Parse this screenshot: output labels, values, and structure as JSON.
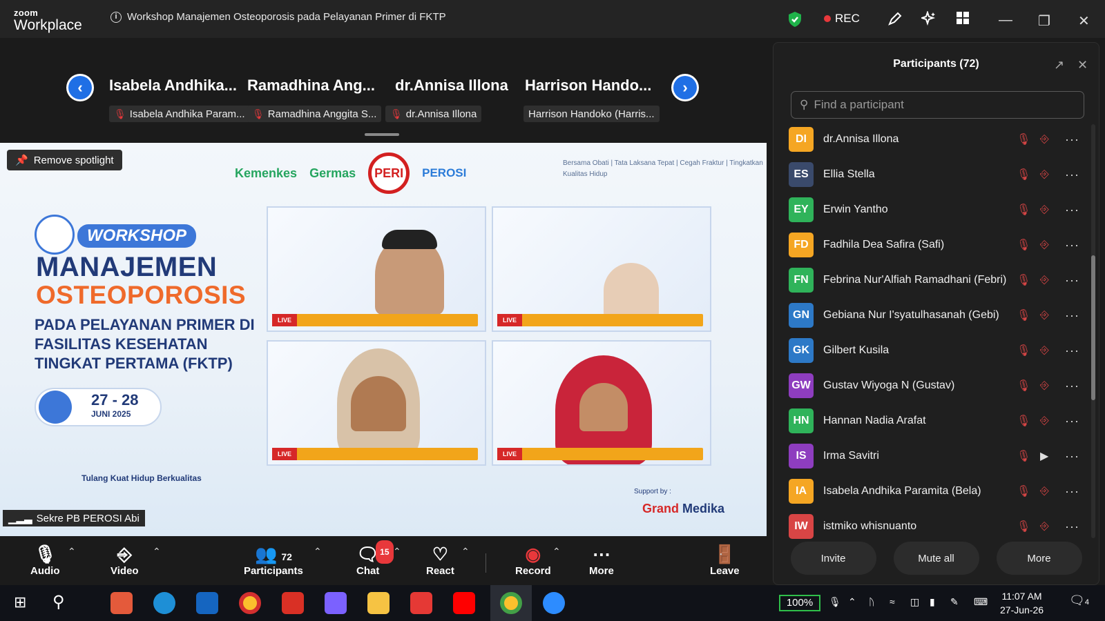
{
  "app": {
    "logo_small": "zoom",
    "logo_big": "Workplace",
    "meeting_title": "Workshop Manajemen Osteoporosis pada Pelayanan Primer di FKTP",
    "rec": "REC"
  },
  "gallery": {
    "tiles": [
      {
        "name": "Isabela  Andhika...",
        "label": "Isabela Andhika Param...",
        "muted": true
      },
      {
        "name": "Ramadhina  Ang...",
        "label": "Ramadhina Anggita S...",
        "muted": true
      },
      {
        "name": "dr.Annisa Illona",
        "label": "dr.Annisa Illona",
        "muted": true
      },
      {
        "name": "Harrison  Hando...",
        "label": "Harrison Handoko (Harris...",
        "muted": false
      }
    ]
  },
  "share": {
    "spotlight": "Remove spotlight",
    "sponsor_1": "Kemenkes",
    "sponsor_2": "Germas",
    "seal": "PERI",
    "sponsor_3": "PEROSI",
    "tagline": "Bersama Obati | Tata Laksana Tepat | Cegah Fraktur | Tingkatkan Kualitas Hidup",
    "badge": "WORKSHOP",
    "title_1": "MANAJEMEN",
    "title_2": "OSTEOPOROSIS",
    "title_3": "PADA PELAYANAN PRIMER DI FASILITAS KESEHATAN TINGKAT PERTAMA (FKTP)",
    "date_1": "27 - 28",
    "date_2": "JUNI 2025",
    "slogan": "Tulang Kuat Hidup Berkualitas",
    "thumb_tag": "LIVE",
    "supported": "Support by :",
    "grand_a": "Grand",
    "grand_b": "Medika",
    "presenter": "Sekre PB PEROSI Abi"
  },
  "participants": {
    "title": "Participants (72)",
    "search_placeholder": "Find a participant",
    "list": [
      {
        "initials": "DI",
        "name": "dr.Annisa Illona",
        "color": "#f5a623",
        "video": false
      },
      {
        "initials": "ES",
        "name": "Ellia Stella",
        "color": "#3a4a6b",
        "video": false
      },
      {
        "initials": "EY",
        "name": "Erwin Yantho",
        "color": "#2fb35a",
        "video": false
      },
      {
        "initials": "FD",
        "name": "Fadhila Dea Safira (Safi)",
        "color": "#f5a623",
        "video": false
      },
      {
        "initials": "FN",
        "name": "Febrina Nur'Alfiah Ramadhani (Febri)",
        "color": "#2fb35a",
        "video": false
      },
      {
        "initials": "GN",
        "name": "Gebiana Nur I'syatulhasanah (Gebi)",
        "color": "#2d79c7",
        "video": false
      },
      {
        "initials": "GK",
        "name": "Gilbert Kusila",
        "color": "#2d79c7",
        "video": false
      },
      {
        "initials": "GW",
        "name": "Gustav Wiyoga N (Gustav)",
        "color": "#8e3dbf",
        "video": false
      },
      {
        "initials": "HN",
        "name": "Hannan Nadia Arafat",
        "color": "#2fb35a",
        "video": false
      },
      {
        "initials": "IS",
        "name": "Irma Savitri",
        "color": "#8e3dbf",
        "video": true
      },
      {
        "initials": "IA",
        "name": "Isabela Andhika Paramita (Bela)",
        "color": "#f5a623",
        "video": false
      },
      {
        "initials": "IW",
        "name": "istmiko whisnuanto",
        "color": "#d84545",
        "video": false
      }
    ],
    "invite": "Invite",
    "mute_all": "Mute all",
    "more": "More"
  },
  "toolbar": {
    "audio": "Audio",
    "video": "Video",
    "participants": "Participants",
    "participants_count": "72",
    "chat": "Chat",
    "chat_badge": "15",
    "react": "React",
    "record": "Record",
    "more": "More",
    "leave": "Leave"
  },
  "taskbar": {
    "battery": "100%",
    "time": "11:07 AM",
    "date": "27-Jun-26",
    "notif": "4"
  }
}
